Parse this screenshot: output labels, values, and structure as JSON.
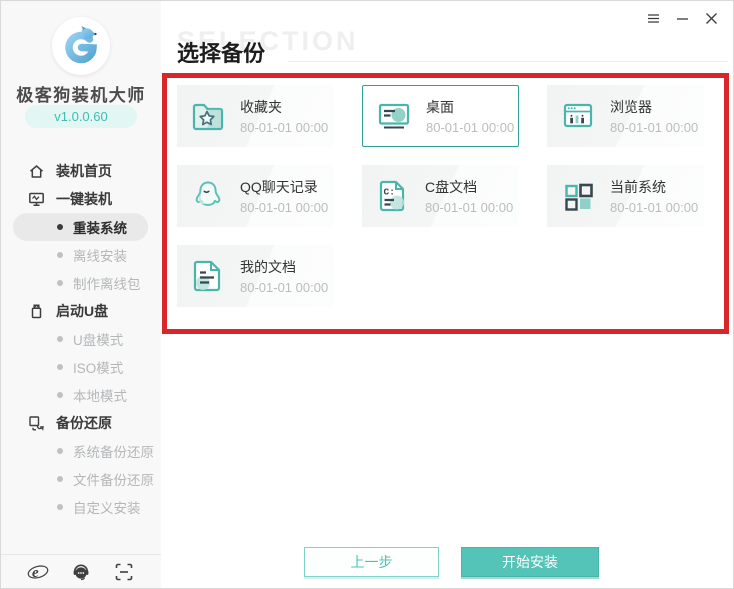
{
  "window": {
    "controls": [
      {
        "name": "menu",
        "icon": "hamburger-menu-icon"
      },
      {
        "name": "minimize",
        "icon": "minimize-icon"
      },
      {
        "name": "close",
        "icon": "close-icon"
      }
    ]
  },
  "sidebar": {
    "app_name": "极客狗装机大师",
    "version": "v1.0.0.60",
    "logo_icon": "geek-dog-logo",
    "menu": [
      {
        "label": "装机首页",
        "level": "top",
        "icon": "home-icon",
        "state": "normal"
      },
      {
        "label": "一键装机",
        "level": "top",
        "icon": "monitor-icon",
        "state": "normal"
      },
      {
        "label": "重装系统",
        "level": "sub",
        "state": "active"
      },
      {
        "label": "离线安装",
        "level": "sub",
        "state": "disabled"
      },
      {
        "label": "制作离线包",
        "level": "sub",
        "state": "disabled"
      },
      {
        "label": "启动U盘",
        "level": "top",
        "icon": "usb-drive-icon",
        "state": "normal"
      },
      {
        "label": "U盘模式",
        "level": "sub",
        "state": "disabled"
      },
      {
        "label": "ISO模式",
        "level": "sub",
        "state": "disabled"
      },
      {
        "label": "本地模式",
        "level": "sub",
        "state": "disabled"
      },
      {
        "label": "备份还原",
        "level": "top",
        "icon": "backup-restore-icon",
        "state": "normal"
      },
      {
        "label": "系统备份还原",
        "level": "sub",
        "state": "disabled"
      },
      {
        "label": "文件备份还原",
        "level": "sub",
        "state": "disabled"
      },
      {
        "label": "自定义安装",
        "level": "sub",
        "state": "disabled"
      }
    ],
    "footer_icons": [
      "ie-browser-icon",
      "headset-support-icon",
      "scan-qr-icon"
    ]
  },
  "main": {
    "title": "选择备份",
    "watermark": "SELECTION",
    "backup_items": [
      {
        "label": "收藏夹",
        "date": "80-01-01 00:00",
        "icon": "favorites-folder-icon",
        "selected": false
      },
      {
        "label": "桌面",
        "date": "80-01-01 00:00",
        "icon": "desktop-icon",
        "selected": true
      },
      {
        "label": "浏览器",
        "date": "80-01-01 00:00",
        "icon": "browser-icon",
        "selected": false
      },
      {
        "label": "QQ聊天记录",
        "date": "80-01-01 00:00",
        "icon": "qq-icon",
        "selected": false
      },
      {
        "label": "C盘文档",
        "date": "80-01-01 00:00",
        "icon": "c-drive-doc-icon",
        "selected": false
      },
      {
        "label": "当前系统",
        "date": "80-01-01 00:00",
        "icon": "current-system-icon",
        "selected": false
      },
      {
        "label": "我的文档",
        "date": "80-01-01 00:00",
        "icon": "my-documents-icon",
        "selected": false
      }
    ],
    "buttons": {
      "previous": "上一步",
      "start_install": "开始安装"
    }
  },
  "colors": {
    "accent_teal": "#4fc0b5",
    "icon_teal": "#4ab5aa",
    "icon_navy": "#37474f",
    "annotation_red": "#d9262b",
    "sidebar_bg": "#f8f8f8",
    "card_bg": "#f4f6f6",
    "version_pill_bg": "#e2f6f3",
    "disabled_text": "#b4b7b9"
  }
}
